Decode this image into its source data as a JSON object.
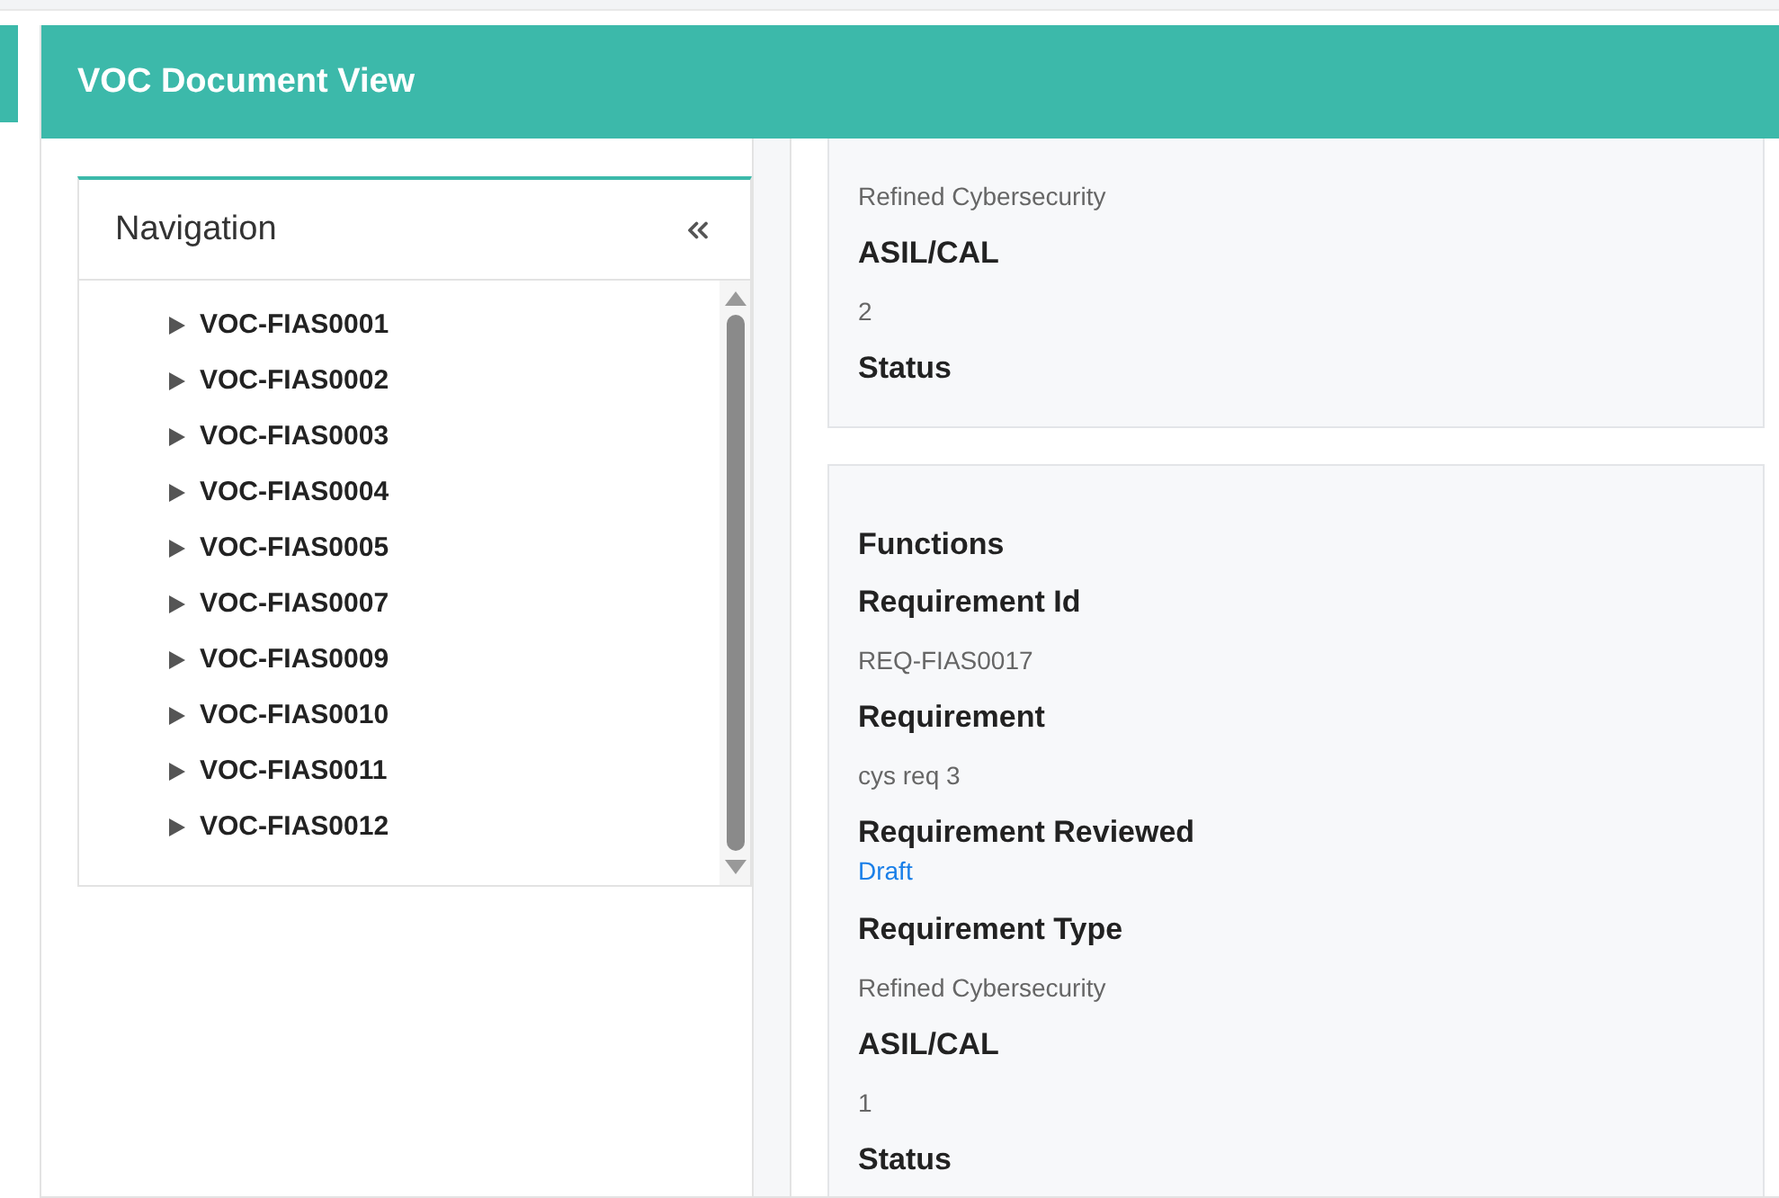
{
  "header": {
    "title": "VOC Document View"
  },
  "navigation": {
    "title": "Navigation",
    "items": [
      {
        "label": "VOC-FIAS0001",
        "expanded": false
      },
      {
        "label": "VOC-FIAS0002",
        "expanded": false
      },
      {
        "label": "VOC-FIAS0003",
        "expanded": false
      },
      {
        "label": "VOC-FIAS0004",
        "expanded": false
      },
      {
        "label": "VOC-FIAS0005",
        "expanded": false
      },
      {
        "label": "VOC-FIAS0007",
        "expanded": false
      },
      {
        "label": "VOC-FIAS0009",
        "expanded": false
      },
      {
        "label": "VOC-FIAS0010",
        "expanded": false
      },
      {
        "label": "VOC-FIAS0011",
        "expanded": false
      },
      {
        "label": "VOC-FIAS0012",
        "expanded": false
      }
    ]
  },
  "cards": [
    {
      "fields": [
        {
          "kind": "value",
          "text": "Refined Cybersecurity"
        },
        {
          "kind": "label",
          "text": "ASIL/CAL"
        },
        {
          "kind": "value",
          "text": "2"
        },
        {
          "kind": "label",
          "text": "Status"
        }
      ]
    },
    {
      "fields": [
        {
          "kind": "label",
          "text": "Functions"
        },
        {
          "kind": "label",
          "text": "Requirement Id"
        },
        {
          "kind": "value",
          "text": "REQ-FIAS0017"
        },
        {
          "kind": "label",
          "text": "Requirement"
        },
        {
          "kind": "value",
          "text": "cys req 3"
        },
        {
          "kind": "label",
          "text": "Requirement Reviewed"
        },
        {
          "kind": "link",
          "text": "Draft"
        },
        {
          "kind": "label",
          "text": "Requirement Type"
        },
        {
          "kind": "value",
          "text": "Refined Cybersecurity"
        },
        {
          "kind": "label",
          "text": "ASIL/CAL"
        },
        {
          "kind": "value",
          "text": "1"
        },
        {
          "kind": "label",
          "text": "Status"
        }
      ]
    }
  ]
}
